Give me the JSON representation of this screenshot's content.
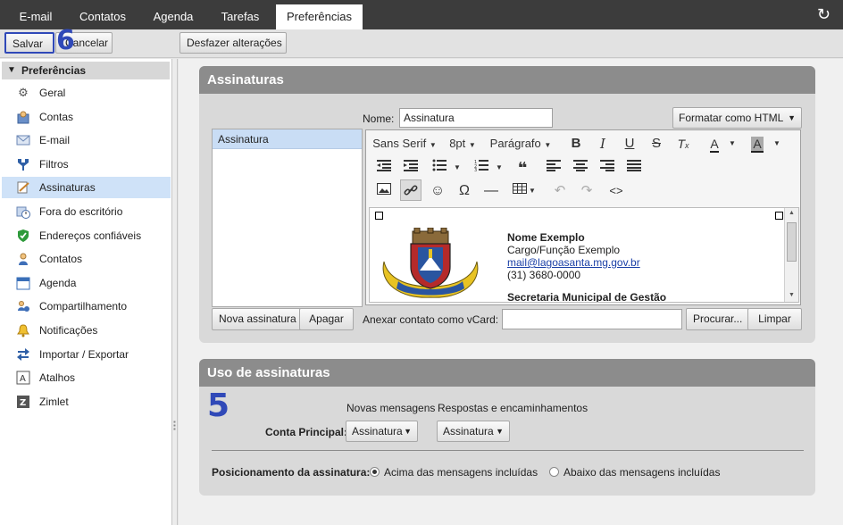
{
  "tabs": [
    {
      "label": "E-mail"
    },
    {
      "label": "Contatos"
    },
    {
      "label": "Agenda"
    },
    {
      "label": "Tarefas"
    },
    {
      "label": "Preferências",
      "active": true
    }
  ],
  "toolbar": {
    "save_label": "Salvar",
    "cancel_label": "Cancelar",
    "undo_label": "Desfazer alterações",
    "annotation_step": "6"
  },
  "sidebar": {
    "header": "Preferências",
    "items": [
      {
        "label": "Geral",
        "icon": "gear-icon"
      },
      {
        "label": "Contas",
        "icon": "accounts-icon"
      },
      {
        "label": "E-mail",
        "icon": "envelope-icon"
      },
      {
        "label": "Filtros",
        "icon": "filter-icon"
      },
      {
        "label": "Assinaturas",
        "icon": "signature-icon",
        "selected": true
      },
      {
        "label": "Fora do escritório",
        "icon": "clock-icon"
      },
      {
        "label": "Endereços confiáveis",
        "icon": "shield-icon"
      },
      {
        "label": "Contatos",
        "icon": "person-icon"
      },
      {
        "label": "Agenda",
        "icon": "calendar-icon"
      },
      {
        "label": "Compartilhamento",
        "icon": "share-icon"
      },
      {
        "label": "Notificações",
        "icon": "bell-icon"
      },
      {
        "label": "Importar / Exportar",
        "icon": "import-export-icon"
      },
      {
        "label": "Atalhos",
        "icon": "keyboard-icon"
      },
      {
        "label": "Zimlet",
        "icon": "zimlet-icon"
      }
    ]
  },
  "signatures": {
    "title": "Assinaturas",
    "list": [
      "Assinatura"
    ],
    "name_label": "Nome:",
    "name_value": "Assinatura",
    "format_label": "Formatar como HTML",
    "editor_toolbar": {
      "font": "Sans Serif",
      "size": "8pt",
      "paragraph": "Parágrafo"
    },
    "content": {
      "name": "Nome Exemplo",
      "role": "Cargo/Função Exemplo",
      "email": "mail@lagoasanta.mg.gov.br",
      "phone": "(31) 3680-0000",
      "department": "Secretaria Municipal de Gestão"
    },
    "new_button": "Nova assinatura",
    "delete_button": "Apagar",
    "vcard_label": "Anexar contato como vCard:",
    "vcard_value": "",
    "browse_button": "Procurar...",
    "clear_button": "Limpar"
  },
  "usage": {
    "title": "Uso de assinaturas",
    "annotation_step": "5",
    "col_new": "Novas mensagens",
    "col_reply": "Respostas e encaminhamentos",
    "account_label": "Conta Principal:",
    "new_value": "Assinatura",
    "reply_value": "Assinatura",
    "position_label": "Posicionamento da assinatura:",
    "option_above": "Acima das mensagens incluídas",
    "option_below": "Abaixo das mensagens incluídas",
    "selected_option": "above"
  },
  "colors": {
    "topbar": "#3c3c3c",
    "panel_header": "#8c8c8c",
    "selection": "#cfe2f8",
    "annotation": "#3049b8"
  }
}
